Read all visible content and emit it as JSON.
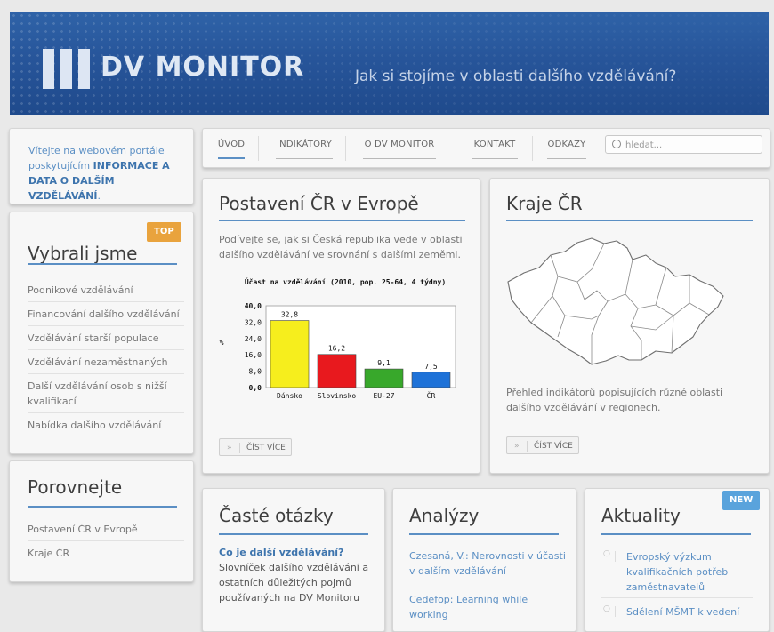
{
  "header": {
    "logo_text": "DV MONITOR",
    "tagline": "Jak si stojíme v oblasti dalšího vzdělávání?"
  },
  "welcome": {
    "text_before": "Vítejte na webovém portále poskytujícím ",
    "text_bold": "INFORMACE A DATA O DALŠÍM VZDĚLÁVÁNÍ",
    "text_after": "."
  },
  "vybrali": {
    "title": "Vybrali jsme",
    "badge": "TOP",
    "items": [
      "Podnikové vzdělávání",
      "Financování dalšího vzdělávání",
      "Vzdělávání starší populace",
      "Vzdělávání nezaměstnaných",
      "Další vzdělávání osob s nižší kvalifikací",
      "Nabídka dalšího vzdělávání"
    ]
  },
  "porovnejte": {
    "title": "Porovnejte",
    "items": [
      "Postavení ČR v Evropě",
      "Kraje ČR"
    ]
  },
  "nav": {
    "tabs": [
      "ÚVOD",
      "INDIKÁTORY",
      "O DV MONITOR",
      "KONTAKT",
      "ODKAZY"
    ],
    "active": 0,
    "search_placeholder": "hledat..."
  },
  "postaveni": {
    "title": "Postavení ČR v Evropě",
    "text": "Podívejte se, jak si Česká republika vede v oblasti dalšího vzdělávání ve srovnání s dalšími zeměmi.",
    "button": "ČÍST VÍCE"
  },
  "kraje": {
    "title": "Kraje ČR",
    "text": "Přehled indikátorů popisujících různé oblasti dalšího vzdělávání v regionech.",
    "button": "ČÍST VÍCE"
  },
  "chart_data": {
    "type": "bar",
    "title": "Účast na vzdělávání (2010, pop. 25-64, 4 týdny)",
    "ylabel": "%",
    "categories": [
      "Dánsko",
      "Slovinsko",
      "EU-27",
      "ČR"
    ],
    "values": [
      32.8,
      16.2,
      9.1,
      7.5
    ],
    "value_labels": [
      "32,8",
      "16,2",
      "9,1",
      "7,5"
    ],
    "ylim": [
      0,
      40
    ],
    "yticks": [
      "0,0",
      "8,0",
      "16,0",
      "24,0",
      "32,0",
      "40,0"
    ],
    "colors": [
      "#f6ee1d",
      "#e8191e",
      "#38a82b",
      "#1e72d8"
    ],
    "grid": false
  },
  "otazky": {
    "title": "Časté otázky",
    "question": "Co je další vzdělávání?",
    "answer": "Slovníček dalšího vzdělávání a ostatních důležitých pojmů používaných na DV Monitoru"
  },
  "analyzy": {
    "title": "Analýzy",
    "items": [
      "Czesaná, V.: Nerovnosti v účasti v dalším vzdělávání",
      "Cedefop: Learning while working"
    ]
  },
  "aktuality": {
    "title": "Aktuality",
    "badge": "NEW",
    "items": [
      "Evropský výzkum kvalifikačních potřeb zaměstnavatelů",
      "Sdělení MŠMT k vedení"
    ]
  }
}
